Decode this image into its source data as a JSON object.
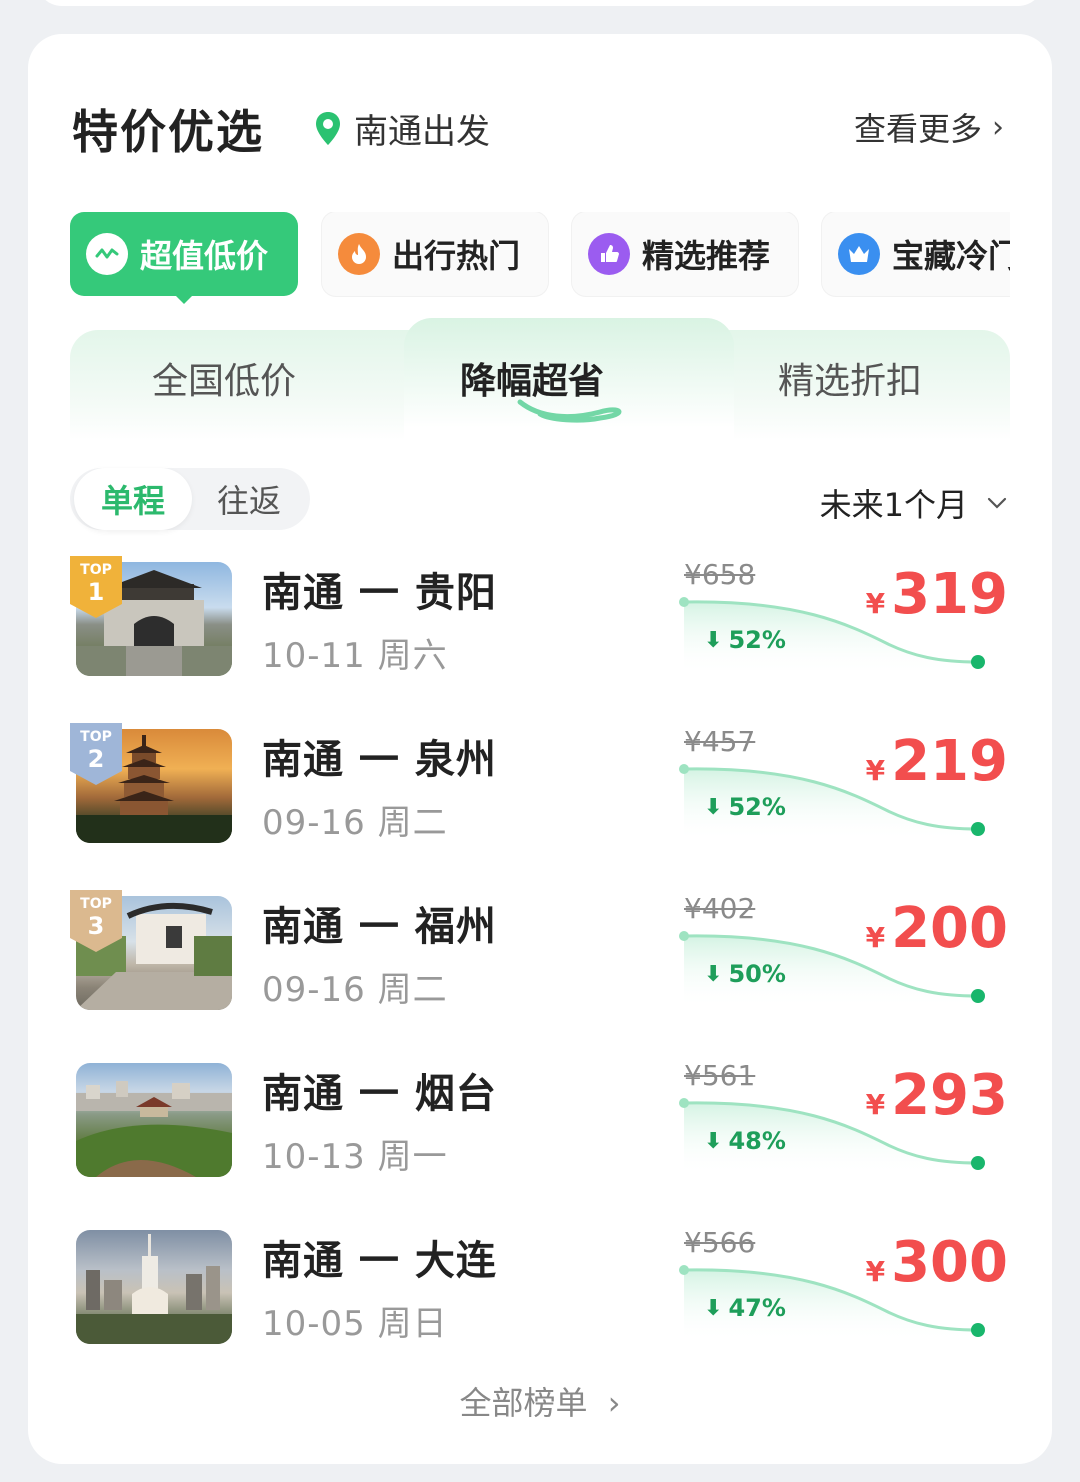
{
  "header": {
    "title": "特价优选",
    "origin": "南通出发",
    "more": "查看更多"
  },
  "categories": [
    {
      "label": "超值低价",
      "active": true,
      "icon": "wave-icon",
      "color": "#35c97a"
    },
    {
      "label": "出行热门",
      "active": false,
      "icon": "flame-icon",
      "color": "#f58b3c"
    },
    {
      "label": "精选推荐",
      "active": false,
      "icon": "thumbs-up-icon",
      "color": "#9b5cf0"
    },
    {
      "label": "宝藏冷门",
      "active": false,
      "icon": "crown-icon",
      "color": "#3a8ff0"
    }
  ],
  "subtabs": [
    {
      "label": "全国低价",
      "active": false
    },
    {
      "label": "降幅超省",
      "active": true
    },
    {
      "label": "精选折扣",
      "active": false
    }
  ],
  "trip_type": {
    "options": [
      "单程",
      "往返"
    ],
    "selected": "单程"
  },
  "period": "未来1个月",
  "currency_symbol": "¥",
  "routes": [
    {
      "badge_top": "TOP",
      "rank": "1",
      "route": "南通 一 贵阳",
      "date": "10-11 周六",
      "old_price": "¥658",
      "drop": "52%",
      "price": "319"
    },
    {
      "badge_top": "TOP",
      "rank": "2",
      "route": "南通 一 泉州",
      "date": "09-16 周二",
      "old_price": "¥457",
      "drop": "52%",
      "price": "219"
    },
    {
      "badge_top": "TOP",
      "rank": "3",
      "route": "南通 一 福州",
      "date": "09-16 周二",
      "old_price": "¥402",
      "drop": "50%",
      "price": "200"
    },
    {
      "badge_top": "",
      "rank": "",
      "route": "南通 一 烟台",
      "date": "10-13 周一",
      "old_price": "¥561",
      "drop": "48%",
      "price": "293"
    },
    {
      "badge_top": "",
      "rank": "",
      "route": "南通 一 大连",
      "date": "10-05 周日",
      "old_price": "¥566",
      "drop": "47%",
      "price": "300"
    }
  ],
  "footer": {
    "label": "全部榜单"
  },
  "colors": {
    "accent": "#35c97a",
    "price": "#f24e4e",
    "drop": "#1e9e5a"
  }
}
